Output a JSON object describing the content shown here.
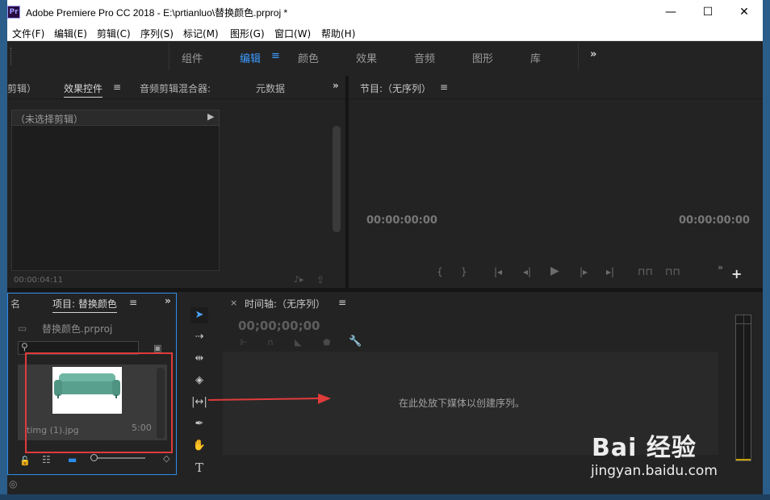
{
  "window": {
    "icon_label": "Pr",
    "title": "Adobe Premiere Pro CC 2018 - E:\\prtianluo\\替换颜色.prproj *",
    "minimize": "—",
    "maximize": "☐",
    "close": "✕"
  },
  "menu": [
    "文件(F)",
    "编辑(E)",
    "剪辑(C)",
    "序列(S)",
    "标记(M)",
    "图形(G)",
    "窗口(W)",
    "帮助(H)"
  ],
  "workspaces": {
    "tabs": [
      "组件",
      "编辑",
      "颜色",
      "效果",
      "音频",
      "图形",
      "库"
    ],
    "active": "编辑",
    "more": "»"
  },
  "effect_panel": {
    "tab_clip": "剪辑）",
    "tab_effects": "效果控件",
    "tab_audio_mixer": "音频剪辑混合器:",
    "tab_metadata": "元数据",
    "no_clip": "（未选择剪辑）",
    "timecode": "00:00:04:11"
  },
  "program_monitor": {
    "title": "节目:（无序列）",
    "tc_left": "00:00:00:00",
    "tc_right": "00:00:00:00"
  },
  "project_panel": {
    "tab_name_stub": "名",
    "title": "项目: 替换颜色",
    "file_name": "替换颜色.prproj",
    "item_name": "timg (1).jpg",
    "item_duration": "5:00"
  },
  "timeline": {
    "title": "时间轴:（无序列）",
    "close": "×",
    "timecode": "00;00;00;00",
    "drop_hint": "在此处放下媒体以创建序列。"
  },
  "watermark": {
    "brand": "Bai 经验",
    "url": "jingyan.baidu.com"
  },
  "colors": {
    "accent": "#3d9bff",
    "annotation": "#e03b3b",
    "panel_bg": "#232323"
  }
}
